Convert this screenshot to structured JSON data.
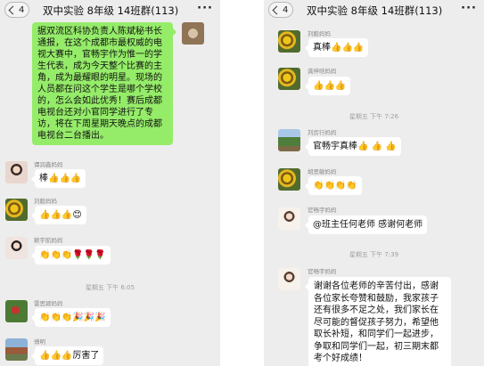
{
  "left": {
    "back_count": "4",
    "title": "双中实验 8年级 14班群(113)",
    "more": "···",
    "green_message": "据双流区科协负责人陈斌秘书长通报，在这个成都市最权威的电视大赛中，官畅宇作为惟一的学生代表，成为今天整个比赛的主角，成为最耀眼的明星。现场的人员都在问这个学生是哪个学校的，怎么会如此优秀！赛后成都电视台还对小官同学进行了专访，将在下周星期天晚点的成都电视台二台播出。",
    "messages": [
      {
        "sender": "谭润鑫妈妈",
        "text": "棒👍👍👍"
      },
      {
        "sender": "刘懿妈妈",
        "text": "👍👍👍😊"
      },
      {
        "sender": "赖宇航妈妈",
        "text": "👏👏👏🌹🌹🌹"
      }
    ],
    "time": "星期五 下午 6:05",
    "messages2": [
      {
        "sender": "雷思颖妈妈",
        "text": "👏👏👏🎉🎉🎉"
      },
      {
        "sender": "傅明",
        "text": "👍👍👍厉害了"
      }
    ]
  },
  "right": {
    "back_count": "4",
    "title": "双中实验 8年级 14班群(113)",
    "more": "···",
    "messages": [
      {
        "sender": "刘懿妈妈",
        "text": "真棒👍👍👍"
      },
      {
        "sender": "龚梓晗妈妈",
        "text": "👍👍👍"
      }
    ],
    "time1": "星期五 下午 7:26",
    "messages2": [
      {
        "sender": "刘厉行妈妈",
        "text": "官畅宇真棒👍 👍 👍"
      },
      {
        "sender": "胡思敏妈妈",
        "text": "👏👏👏👏"
      },
      {
        "sender": "官畅宇妈妈",
        "text": "@班主任何老师 感谢何老师"
      }
    ],
    "time2": "星期五 下午 7:39",
    "final": {
      "sender": "官畅宇妈妈",
      "text": "谢谢各位老师的辛苦付出，感谢各位家长夸赞和鼓励，我家孩子还有很多不足之处，我们家长在尽可能的督促孩子努力，希望他取长补短，和同学们一起进步，争取和同学们一起，初三期末都考个好成绩！"
    }
  }
}
